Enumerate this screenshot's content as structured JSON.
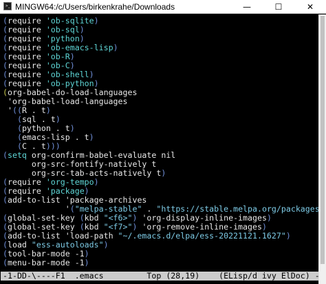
{
  "window": {
    "title": "MINGW64:/c/Users/birkenkrahe/Downloads",
    "icon": "terminal-icon",
    "minimize_glyph": "—",
    "maximize_glyph": "☐",
    "close_glyph": "✕"
  },
  "colors": {
    "background": "#000000",
    "text": "#f2f2f2",
    "paren": "#6f8fd8",
    "keyword": "#5fd7d7",
    "string": "#7ecbe6",
    "modeline_bg": "#cccccc"
  },
  "editor": {
    "lines": [
      [
        {
          "t": "(",
          "c": "paren"
        },
        {
          "t": "require ",
          "c": "sym"
        },
        {
          "t": "'ob-sqlite",
          "c": "kw"
        },
        {
          "t": ")",
          "c": "paren"
        }
      ],
      [
        {
          "t": "(",
          "c": "paren"
        },
        {
          "t": "require ",
          "c": "sym"
        },
        {
          "t": "'ob-sql",
          "c": "kw"
        },
        {
          "t": ")",
          "c": "paren"
        }
      ],
      [
        {
          "t": "(",
          "c": "paren"
        },
        {
          "t": "require ",
          "c": "sym"
        },
        {
          "t": "'python",
          "c": "kw"
        },
        {
          "t": ")",
          "c": "paren"
        }
      ],
      [
        {
          "t": "(",
          "c": "paren"
        },
        {
          "t": "require ",
          "c": "sym"
        },
        {
          "t": "'ob-emacs-lisp",
          "c": "kw"
        },
        {
          "t": ")",
          "c": "paren"
        }
      ],
      [
        {
          "t": "(",
          "c": "paren"
        },
        {
          "t": "require ",
          "c": "sym"
        },
        {
          "t": "'ob-R",
          "c": "kw"
        },
        {
          "t": ")",
          "c": "paren"
        }
      ],
      [
        {
          "t": "(",
          "c": "paren"
        },
        {
          "t": "require ",
          "c": "sym"
        },
        {
          "t": "'ob-C",
          "c": "kw"
        },
        {
          "t": ")",
          "c": "paren"
        }
      ],
      [
        {
          "t": "(",
          "c": "paren"
        },
        {
          "t": "require ",
          "c": "sym"
        },
        {
          "t": "'ob-shell",
          "c": "kw"
        },
        {
          "t": ")",
          "c": "paren"
        }
      ],
      [
        {
          "t": "(",
          "c": "paren"
        },
        {
          "t": "require ",
          "c": "sym"
        },
        {
          "t": "'ob-python",
          "c": "kw"
        },
        {
          "t": ")",
          "c": "paren"
        }
      ],
      [
        {
          "t": "(",
          "c": "paren-y"
        },
        {
          "t": "org-babel-do-load-languages",
          "c": "sym"
        }
      ],
      [
        {
          "t": " 'org-babel-load-languages",
          "c": "sym"
        }
      ],
      [
        {
          "t": " '",
          "c": "quote"
        },
        {
          "t": "((",
          "c": "paren"
        },
        {
          "t": "R . t",
          "c": "sym"
        },
        {
          "t": ")",
          "c": "paren"
        }
      ],
      [
        {
          "t": "   ",
          "c": "sym"
        },
        {
          "t": "(",
          "c": "paren"
        },
        {
          "t": "sql . t",
          "c": "sym"
        },
        {
          "t": ")",
          "c": "paren"
        }
      ],
      [
        {
          "t": "   ",
          "c": "sym"
        },
        {
          "t": "(",
          "c": "paren"
        },
        {
          "t": "python . t",
          "c": "sym"
        },
        {
          "t": ")",
          "c": "paren"
        }
      ],
      [
        {
          "t": "   ",
          "c": "sym"
        },
        {
          "t": "(",
          "c": "paren"
        },
        {
          "t": "emacs-lisp . t",
          "c": "sym"
        },
        {
          "t": ")",
          "c": "paren"
        }
      ],
      [
        {
          "t": "   ",
          "c": "sym"
        },
        {
          "t": "(",
          "c": "paren"
        },
        {
          "t": "C . t",
          "c": "sym"
        },
        {
          "t": ")))",
          "c": "paren"
        }
      ],
      [
        {
          "t": "(",
          "c": "paren"
        },
        {
          "t": "setq ",
          "c": "kw"
        },
        {
          "t": "org-confirm-babel-evaluate nil",
          "c": "sym"
        }
      ],
      [
        {
          "t": "      org-src-fontify-natively t",
          "c": "sym"
        }
      ],
      [
        {
          "t": "      org-src-tab-acts-natively t",
          "c": "sym"
        },
        {
          "t": ")",
          "c": "paren"
        }
      ],
      [
        {
          "t": "(",
          "c": "paren"
        },
        {
          "t": "require ",
          "c": "sym"
        },
        {
          "t": "'org-tempo",
          "c": "kw"
        },
        {
          "t": ")",
          "c": "paren"
        }
      ],
      [
        {
          "t": "(",
          "c": "paren"
        },
        {
          "t": "require ",
          "c": "sym"
        },
        {
          "t": "'package",
          "c": "kw"
        },
        {
          "t": ")",
          "c": "paren"
        }
      ],
      [
        {
          "t": "(",
          "c": "paren"
        },
        {
          "t": "add-to-list 'package-archives",
          "c": "sym"
        }
      ],
      [
        {
          "t": "             '",
          "c": "quote"
        },
        {
          "t": "(",
          "c": "paren"
        },
        {
          "t": "\"melpa-stable\"",
          "c": "str"
        },
        {
          "t": " . ",
          "c": "sym"
        },
        {
          "t": "\"https://stable.melpa.org/packages/\"",
          "c": "str"
        },
        {
          "t": "))",
          "c": "paren"
        }
      ],
      [
        {
          "t": "(",
          "c": "paren"
        },
        {
          "t": "global-set-key ",
          "c": "sym"
        },
        {
          "t": "(",
          "c": "paren"
        },
        {
          "t": "kbd ",
          "c": "sym"
        },
        {
          "t": "\"<f6>\"",
          "c": "str"
        },
        {
          "t": ")",
          "c": "paren"
        },
        {
          "t": " 'org-display-inline-images",
          "c": "sym"
        },
        {
          "t": ")",
          "c": "paren"
        }
      ],
      [
        {
          "t": "(",
          "c": "paren"
        },
        {
          "t": "global-set-key ",
          "c": "sym"
        },
        {
          "t": "(",
          "c": "paren"
        },
        {
          "t": "kbd ",
          "c": "sym"
        },
        {
          "t": "\"<f7>\"",
          "c": "str"
        },
        {
          "t": ")",
          "c": "paren"
        },
        {
          "t": " 'org-remove-inline-images",
          "c": "sym"
        },
        {
          "t": ")",
          "c": "paren"
        }
      ],
      [
        {
          "t": "(",
          "c": "paren"
        },
        {
          "t": "add-to-list 'load-path ",
          "c": "sym"
        },
        {
          "t": "\"~/.emacs.d/elpa/ess-20221121.1627\"",
          "c": "str"
        },
        {
          "t": ")",
          "c": "paren"
        }
      ],
      [
        {
          "t": "(",
          "c": "paren"
        },
        {
          "t": "load ",
          "c": "sym"
        },
        {
          "t": "\"ess-autoloads\"",
          "c": "str"
        },
        {
          "t": ")",
          "c": "paren"
        }
      ],
      [
        {
          "t": "(",
          "c": "paren"
        },
        {
          "t": "tool-bar-mode -1",
          "c": "sym"
        },
        {
          "t": ")",
          "c": "paren"
        }
      ],
      [
        {
          "t": "(",
          "c": "paren"
        },
        {
          "t": "menu-bar-mode -1",
          "c": "sym"
        },
        {
          "t": ")",
          "c": "paren"
        }
      ]
    ]
  },
  "modeline": {
    "text": "-1-DD-\\----F1  .emacs         Top (28,19)    (ELisp/d ivy ElDoc) --------"
  }
}
